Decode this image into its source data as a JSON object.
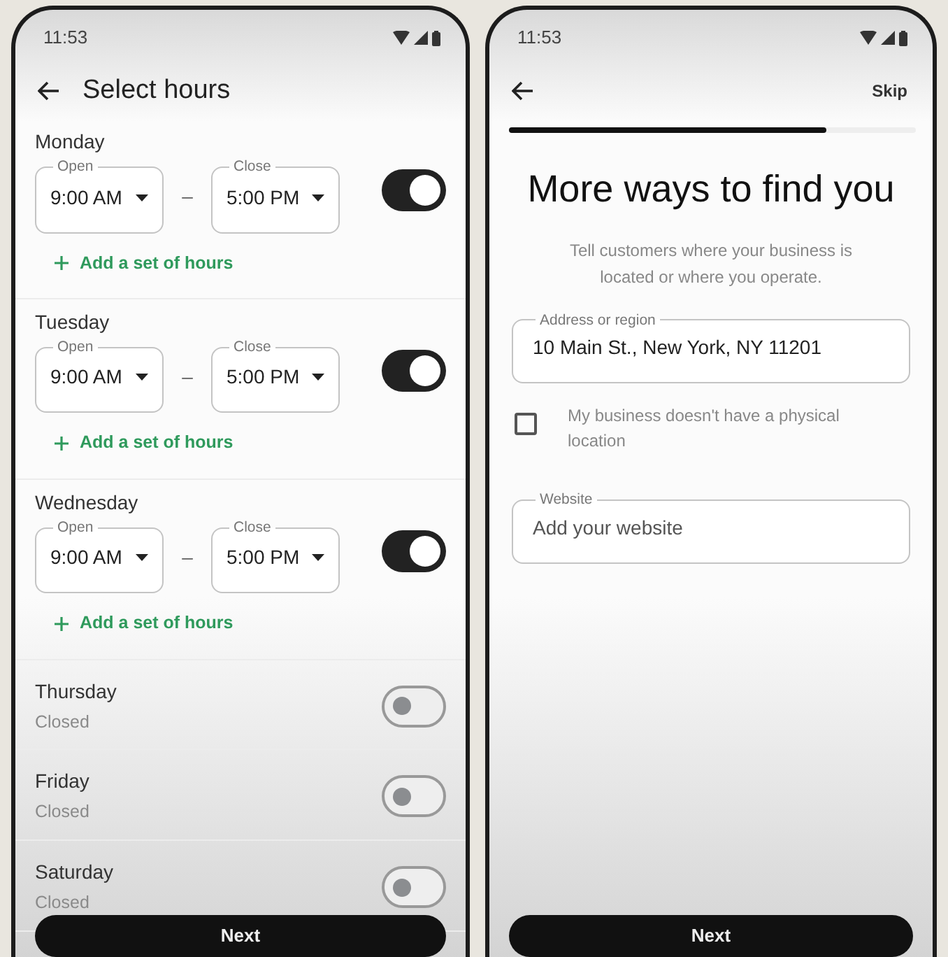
{
  "hours_screen": {
    "status_time": "11:53",
    "title": "Select hours",
    "days": [
      {
        "name": "Monday",
        "on": true,
        "open_label": "Open",
        "open_value": "9:00 AM",
        "separator": "–",
        "close_label": "Close",
        "close_value": "5:00 PM",
        "add_label": "Add a set of hours"
      },
      {
        "name": "Tuesday",
        "on": true,
        "open_label": "Open",
        "open_value": "9:00 AM",
        "separator": "–",
        "close_label": "Close",
        "close_value": "5:00 PM",
        "add_label": "Add a set of hours"
      },
      {
        "name": "Wednesday",
        "on": true,
        "open_label": "Open",
        "open_value": "9:00 AM",
        "separator": "–",
        "close_label": "Close",
        "close_value": "5:00 PM",
        "add_label": "Add a set of hours"
      },
      {
        "name": "Thursday",
        "on": false,
        "status": "Closed"
      },
      {
        "name": "Friday",
        "on": false,
        "status": "Closed"
      },
      {
        "name": "Saturday",
        "on": false,
        "status": "Closed"
      }
    ],
    "next_button": "Next"
  },
  "location_screen": {
    "status_time": "11:53",
    "skip": "Skip",
    "progress": {
      "level": 0.78
    },
    "title": "More ways to find you",
    "subtitle": "Tell customers where your business is located or where you operate.",
    "address": {
      "label": "Address or region",
      "value": "10 Main St., New York, NY 11201"
    },
    "no_location": {
      "label": "My business doesn't have a physical location",
      "checked": false
    },
    "website": {
      "label": "Website",
      "placeholder": "Add your website"
    },
    "next_button": "Next"
  }
}
